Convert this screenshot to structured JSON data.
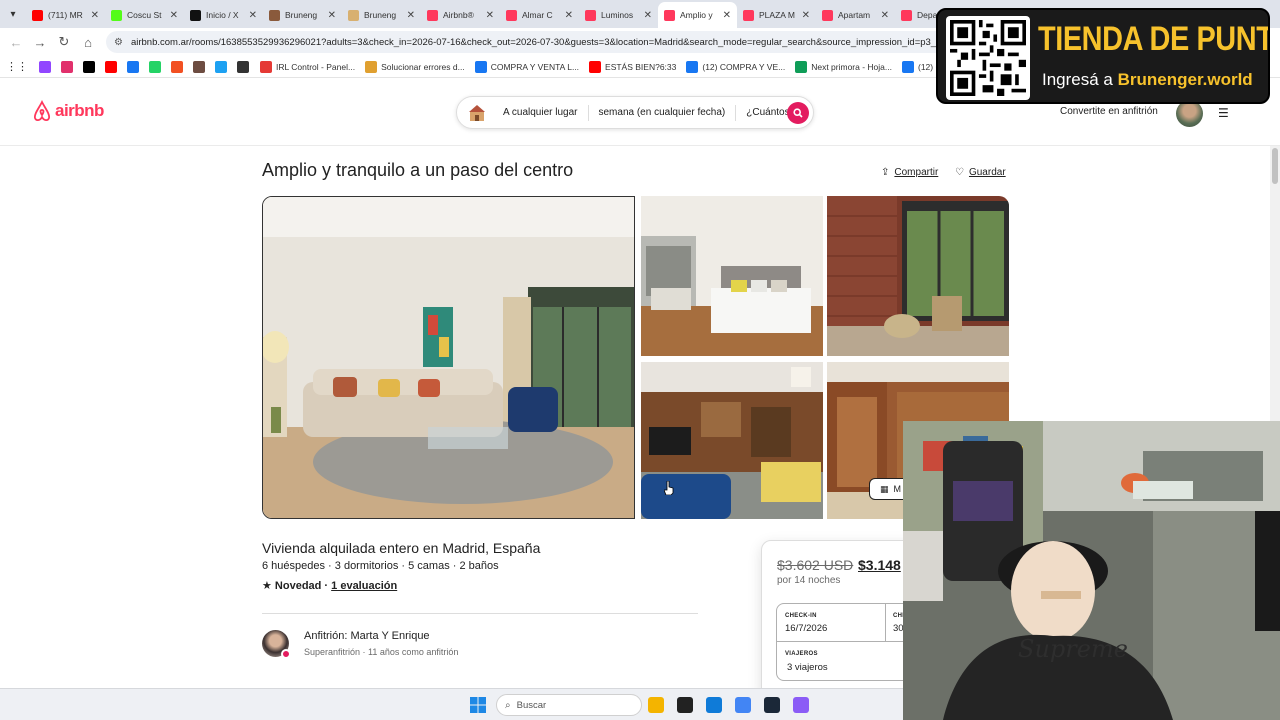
{
  "browser": {
    "tabs": [
      {
        "label": "(711) MR",
        "color": "#ff0000"
      },
      {
        "label": "Coscu St",
        "color": "#53fc18"
      },
      {
        "label": "Inicio / X",
        "color": "#111111"
      },
      {
        "label": "Bruneng",
        "color": "#8a5a3c"
      },
      {
        "label": "Bruneng",
        "color": "#d8b070"
      },
      {
        "label": "Airbnb®",
        "color": "#ff385c"
      },
      {
        "label": "Almar C",
        "color": "#ff385c"
      },
      {
        "label": "Luminos",
        "color": "#ff385c"
      },
      {
        "label": "Amplio y",
        "color": "#ff385c",
        "active": true
      },
      {
        "label": "PLAZA M",
        "color": "#ff385c"
      },
      {
        "label": "Apartam",
        "color": "#ff385c"
      },
      {
        "label": "Depa",
        "color": "#ff385c"
      }
    ],
    "close_glyph": "✕",
    "url": "airbnb.com.ar/rooms/1638553529936296021?adults=3&check_in=2026-07-16&check_out=2026-07-30&guests=3&location=Madrid&search_mode=regular_search&source_impression_id=p3_1775",
    "bookmarks": [
      {
        "label": "IRL Control - Panel...",
        "color": "#e53935"
      },
      {
        "label": "Solucionar errores d...",
        "color": "#e0a030"
      },
      {
        "label": "COMPRA Y VENTA L...",
        "color": "#1877f2"
      },
      {
        "label": "ESTÁS BIEN?6:33",
        "color": "#ff0000"
      },
      {
        "label": "(12) COMPRA Y VE...",
        "color": "#1877f2"
      },
      {
        "label": "Next primora - Hoja...",
        "color": "#0f9d58"
      },
      {
        "label": "(12) COMPRA Y VE...",
        "color": "#1877f2"
      }
    ],
    "bookmark_icon_colors": [
      "#9146ff",
      "#e1306c",
      "#000000",
      "#ff0000",
      "#1877f2",
      "#25d366",
      "#f25022",
      "#6d4c41",
      "#1da1f2",
      "#333333"
    ]
  },
  "header": {
    "logo_text": "airbnb",
    "search": {
      "where": "A cualquier lugar",
      "when": "semana (en cualquier fecha)",
      "who": "¿Cuántos?"
    },
    "host_link": "Convertite en anfitrión"
  },
  "overlay": {
    "title": "TIENDA DE PUNTOS",
    "subtitle_prefix": "Ingresá a ",
    "subtitle_link": "Brunenger.world"
  },
  "listing": {
    "title": "Amplio y tranquilo a un paso del centro",
    "share_label": "Compartir",
    "save_label": "Guardar",
    "show_all_label": "M",
    "subtitle": "Vivienda alquilada entero en Madrid, España",
    "specs": "6 huéspedes · 3 dormitorios · 5 camas · 2 baños",
    "rating_prefix": "★ Novedad · ",
    "rating_link": "1 evaluación",
    "host_name": "Anfitrión: Marta Y Enrique",
    "host_sub": "Superanfitrión · 11 años como anfitrión"
  },
  "booking": {
    "price_old": "$3.602 USD",
    "price_new": "$3.148",
    "nights": "por 14 noches",
    "checkin_label": "CHECK-IN",
    "checkin_value": "16/7/2026",
    "checkout_label": "CHE",
    "checkout_value": "30",
    "travelers_label": "VIAJEROS",
    "travelers_value": "3 viajeros"
  },
  "taskbar": {
    "search_placeholder": "Buscar",
    "icon_colors": [
      "#f4b400",
      "#222222",
      "#0f7bd8",
      "#4285f4",
      "#1b2838",
      "#8b5cf6"
    ]
  }
}
